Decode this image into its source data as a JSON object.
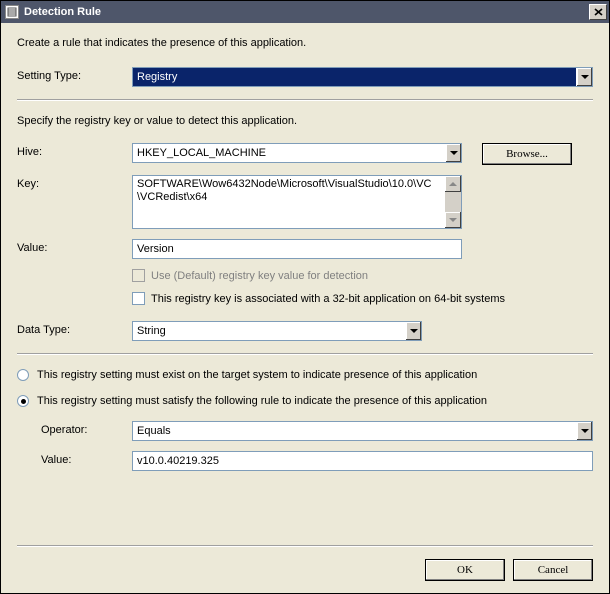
{
  "window": {
    "title": "Detection Rule"
  },
  "intro": "Create a rule that indicates the presence of this application.",
  "settingType": {
    "label": "Setting Type:",
    "value": "Registry"
  },
  "registrySection": {
    "intro": "Specify the registry key or value to detect this application.",
    "hive": {
      "label": "Hive:",
      "value": "HKEY_LOCAL_MACHINE"
    },
    "browse": "Browse...",
    "key": {
      "label": "Key:",
      "value": "SOFTWARE\\Wow6432Node\\Microsoft\\VisualStudio\\10.0\\VC\\VCRedist\\x64"
    },
    "value": {
      "label": "Value:",
      "value": "Version"
    },
    "useDefault": "Use (Default) registry key value for detection",
    "assoc32": "This registry key is associated with a 32-bit application on 64-bit systems",
    "dataType": {
      "label": "Data Type:",
      "value": "String"
    }
  },
  "rule": {
    "optExist": "This registry setting must exist on the target system to indicate presence of this application",
    "optSatisfy": "This registry setting must satisfy the following rule to indicate the presence of this application",
    "operator": {
      "label": "Operator:",
      "value": "Equals"
    },
    "value": {
      "label": "Value:",
      "value": "v10.0.40219.325"
    }
  },
  "buttons": {
    "ok": "OK",
    "cancel": "Cancel"
  }
}
